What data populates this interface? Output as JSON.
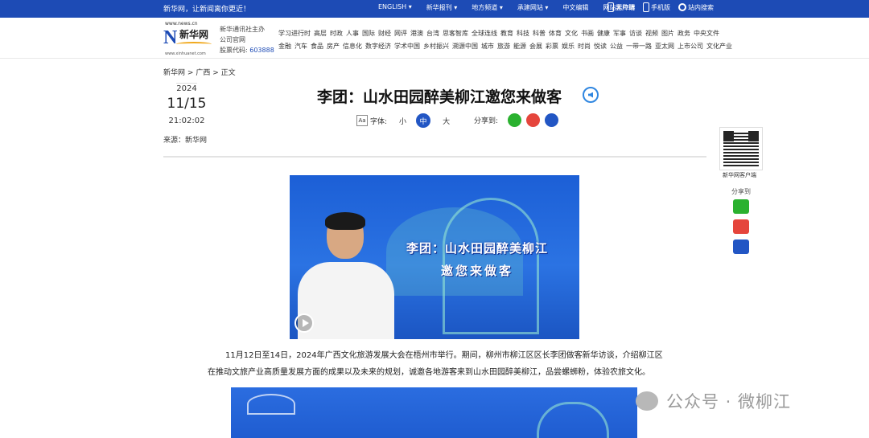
{
  "topbar": {
    "slogan": "新华网，让新闻离你更近！",
    "links": [
      "ENGLISH ▾",
      "新华报刊 ▾",
      "地方频道 ▾",
      "承建网站 ▾",
      "中文编辑",
      "网站无障碍"
    ],
    "client": "客户端",
    "mobile": "手机版",
    "search": "站内搜索"
  },
  "header": {
    "logo_url": "www.news.cn",
    "logo_big": "N",
    "logo_cn": "新华网",
    "logo_en": "www.xinhuanet.com",
    "org_line1": "新华通讯社主办",
    "org_line2": "公司官网",
    "stock_label": "股票代码:",
    "stock_code": "603888",
    "nav_row1": [
      "学习进行时",
      "高层",
      "时政",
      "人事",
      "国际",
      "财经",
      "网评",
      "港澳",
      "台湾",
      "思客智库",
      "全球连线",
      "教育",
      "科技",
      "科普",
      "体育",
      "文化",
      "书画",
      "健康",
      "军事",
      "访谈",
      "视频",
      "图片",
      "政务",
      "中央文件"
    ],
    "nav_row2": [
      "金融",
      "汽车",
      "食品",
      "房产",
      "信息化",
      "数字经济",
      "学术中国",
      "乡村振兴",
      "溯源中国",
      "城市",
      "旅游",
      "能源",
      "会展",
      "彩票",
      "娱乐",
      "时尚",
      "悦读",
      "公益",
      "一带一路",
      "亚太网",
      "上市公司",
      "文化产业"
    ]
  },
  "breadcrumb": {
    "home": "新华网",
    "sep": ">",
    "region": "广西",
    "current": "正文"
  },
  "date": {
    "year": "2024",
    "month_day": "11/15",
    "time": "21:02:02"
  },
  "source": "来源：新华网",
  "article": {
    "title": "李团：山水田园醉美柳江邀您来做客",
    "font_label": "字体:",
    "font_icon": "Aa",
    "font_small": "小",
    "font_mid": "中",
    "font_large": "大",
    "share_label": "分享到:",
    "hero_title": "李团：山水田园醉美柳江",
    "hero_sub": "邀您来做客",
    "para_line1": "11月12日至14日，2024年广西文化旅游发展大会在梧州市举行。期间，柳州市柳江区区长李团做客新华访谈，介绍柳江区",
    "para_line2": "在推动文旅产业高质量发展方面的成果以及未来的规划，诚邀各地游客来到山水田园醉美柳江，品尝螺蛳粉，体验农旅文化。"
  },
  "rail": {
    "qr_caption": "新华网客户端",
    "share_label": "分享到"
  },
  "watermark": "公众号 · 微柳江",
  "colors": {
    "brand": "#1d4bb5",
    "wechat": "#2ab12f",
    "weibo": "#e5453c",
    "accent": "#2256c4"
  }
}
